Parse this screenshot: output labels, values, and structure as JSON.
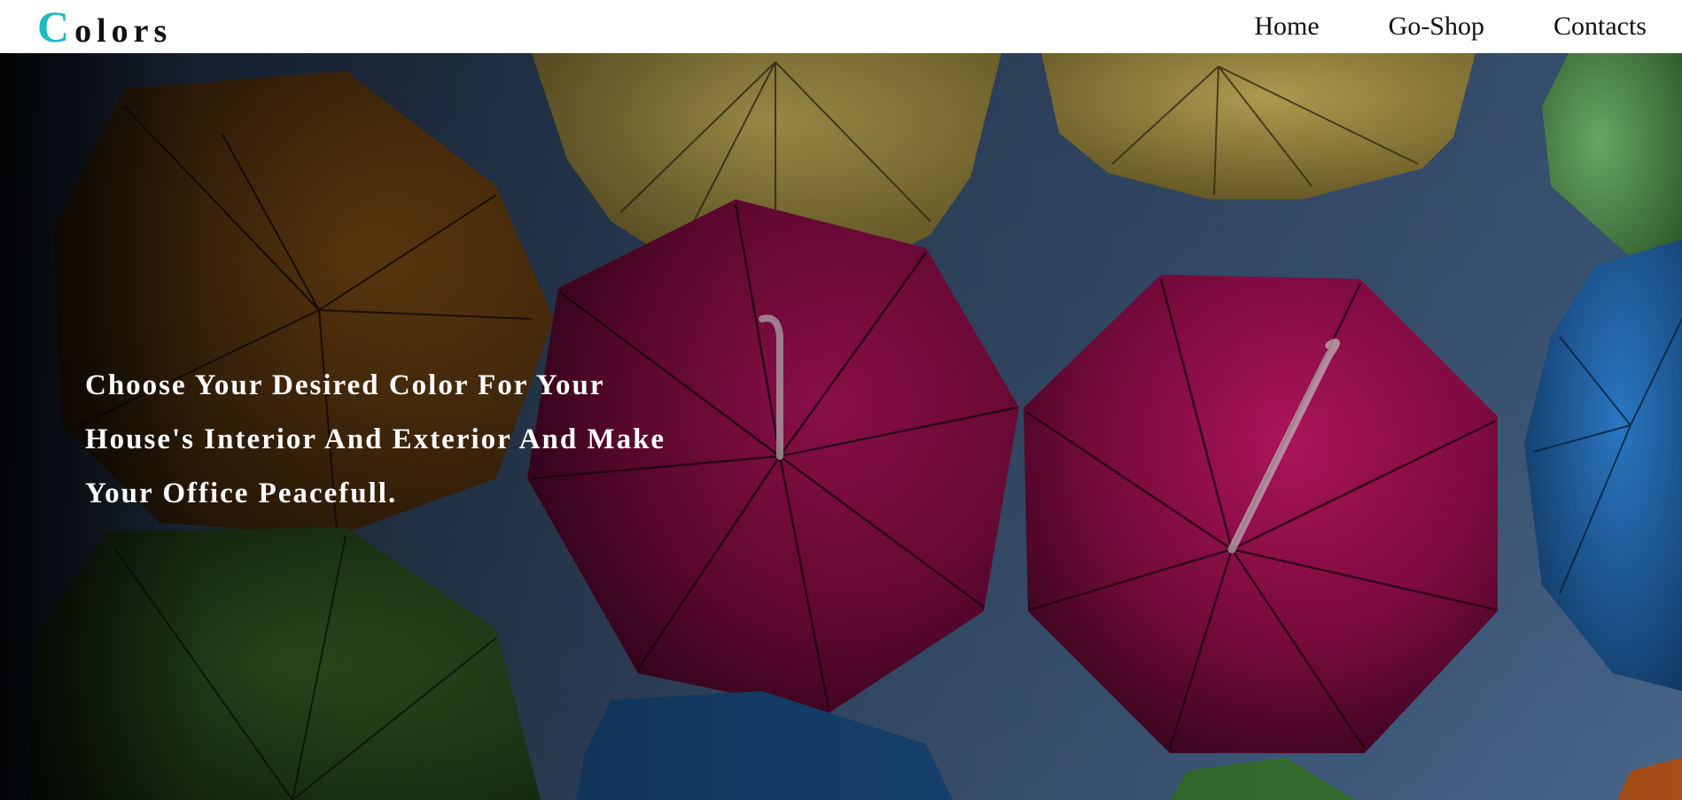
{
  "header": {
    "logo_initial": "C",
    "logo_rest": "olors",
    "nav": [
      {
        "label": "Home"
      },
      {
        "label": "Go-Shop"
      },
      {
        "label": "Contacts"
      }
    ]
  },
  "hero": {
    "headline_lines": [
      "Choose Your Desired Color For Your",
      "House's Interior And Exterior And Make",
      "Your Office Peacefull."
    ],
    "background_image": "umbrellas-photo"
  },
  "colors": {
    "accent": "#1fb9c4",
    "nav_text": "#111111",
    "hero_text": "#ffffff",
    "sky": "#3a5273",
    "umbrella_magenta": "#9b0f4f",
    "umbrella_yellow": "#a38f3a",
    "umbrella_orange": "#8a4f12",
    "umbrella_green": "#3b6b2a",
    "umbrella_blue": "#1f5d9c"
  }
}
